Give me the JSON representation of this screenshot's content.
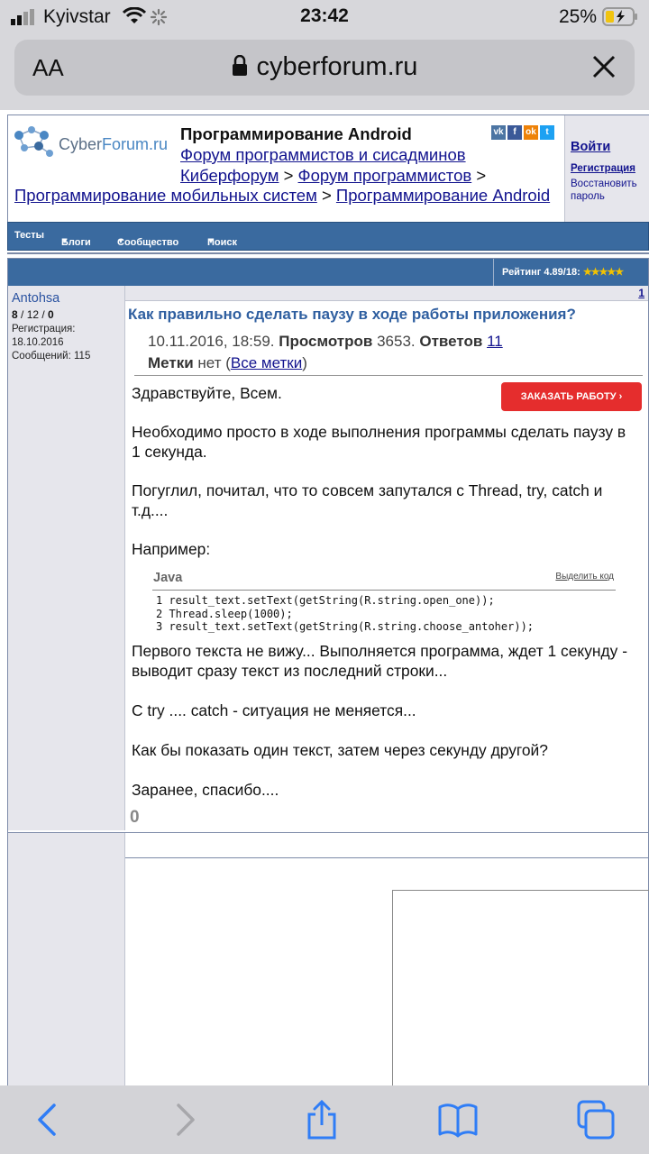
{
  "status": {
    "carrier": "Kyivstar",
    "time": "23:42",
    "battery": "25%"
  },
  "safari": {
    "text_size": "AA",
    "url": "cyberforum.ru"
  },
  "site": {
    "logo_text_a": "Cyber",
    "logo_text_b": "Forum.ru",
    "title": "Программирование Android",
    "crumb_link1": "Форум программистов и сисадминов",
    "crumb_link2": "Киберфорум",
    "crumb_sep": ">",
    "crumb_link3": "Форум программистов",
    "crumb_link4": "Программирование мобильных систем",
    "crumb_link5": "Программирование Android",
    "social": [
      "vk",
      "f",
      "ok",
      "t"
    ],
    "login": "Войти",
    "register": "Регистрация",
    "restore": "Восстановить пароль"
  },
  "nav": {
    "items": [
      "Тесты",
      "Блоги",
      "Сообщество",
      "Поиск"
    ]
  },
  "post": {
    "rating": "Рейтинг 4.89/18:",
    "stars": "★★★★★",
    "number": "1",
    "author": "Antohsa",
    "counts_a": "8",
    "counts_b": " / 12 / ",
    "counts_c": "0",
    "reg_label": "Регистрация:",
    "reg_date": "18.10.2016",
    "messages": "Сообщений: 115",
    "title": "Как правильно сделать паузу в ходе работы приложения?",
    "date": "10.11.2016, 18:59.",
    "views_label": "Просмотров",
    "views": "3653.",
    "answers_label": "Ответов",
    "answers": "11",
    "tags_label": "Метки",
    "tags_value": "нет",
    "all_tags": "Все метки",
    "order_button": "ЗАКАЗАТЬ РАБОТУ  ›",
    "p1": "Здравствуйте, Всем.",
    "p2": "Необходимо просто в ходе выполнения программы сделать паузу в 1 секунда.",
    "p3": "Погуглил, почитал, что то совсем запутался с Thread, try, catch и т.д....",
    "p4": "Например:",
    "code_lang": "Java",
    "code_select": "Выделить код",
    "code_lines": [
      "1 result_text.setText(getString(R.string.open_one));",
      "2 Thread.sleep(1000);",
      "3 result_text.setText(getString(R.string.choose_antoher));"
    ],
    "p5": "Первого текста не вижу... Выполняется программа, ждет 1 секунду - выводит сразу текст из последний строки...",
    "p6": "С try .... catch - ситуация не меняется...",
    "p7": "Как бы показать один текст, затем через секунду другой?",
    "p8": "Заранее, спасибо....",
    "likes": "0"
  }
}
